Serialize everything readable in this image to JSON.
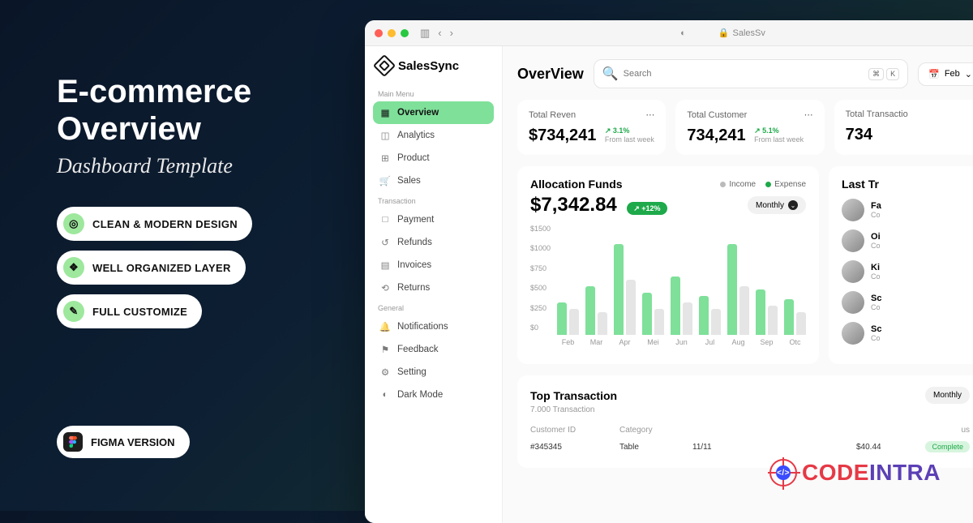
{
  "promo": {
    "title_l1": "E-commerce",
    "title_l2": "Overview",
    "subtitle": "Dashboard Template",
    "feat1": "CLEAN & MODERN DESIGN",
    "feat2": "WELL ORGANIZED LAYER",
    "feat3": "FULL CUSTOMIZE",
    "figma": "FIGMA VERSION"
  },
  "titlebar": {
    "url": "SalesSv"
  },
  "brand": "SalesSync",
  "nav": {
    "sec1": "Main Menu",
    "overview": "Overview",
    "analytics": "Analytics",
    "product": "Product",
    "sales": "Sales",
    "sec2": "Transaction",
    "payment": "Payment",
    "refunds": "Refunds",
    "invoices": "Invoices",
    "returns": "Returns",
    "sec3": "General",
    "notifications": "Notifications",
    "feedback": "Feedback",
    "setting": "Setting",
    "darkmode": "Dark Mode"
  },
  "header": {
    "title": "OverView",
    "search_placeholder": "Search",
    "kbd1": "⌘",
    "kbd2": "K",
    "month": "Feb"
  },
  "stats": {
    "s1_label": "Total Reven",
    "s1_val": "$734,241",
    "s1_pct": "↗ 3.1%",
    "s1_sub": "From last week",
    "s2_label": "Total Customer",
    "s2_val": "734,241",
    "s2_pct": "↗ 5.1%",
    "s2_sub": "From last week",
    "s3_label": "Total Transactio",
    "s3_val": "734"
  },
  "alloc": {
    "title": "Allocation Funds",
    "legend_income": "Income",
    "legend_expense": "Expense",
    "amount": "$7,342.84",
    "delta": "↗ +12%",
    "period": "Monthly"
  },
  "chart_data": {
    "type": "bar",
    "title": "Allocation Funds",
    "ylabel": "",
    "xlabel": "",
    "ylim": [
      0,
      1500
    ],
    "yticks": [
      "$1500",
      "$1000",
      "$750",
      "$500",
      "$250",
      "$0"
    ],
    "categories": [
      "Feb",
      "Mar",
      "Apr",
      "Mei",
      "Jun",
      "Jul",
      "Aug",
      "Sep",
      "Otc"
    ],
    "series": [
      {
        "name": "Income",
        "values": [
          500,
          750,
          1400,
          650,
          900,
          600,
          1400,
          700,
          550
        ]
      },
      {
        "name": "Expense",
        "values": [
          400,
          350,
          850,
          400,
          500,
          400,
          750,
          450,
          350
        ]
      }
    ]
  },
  "lasttr": {
    "title": "Last Tr",
    "items": [
      {
        "name": "Fa",
        "sub": "Co"
      },
      {
        "name": "Oi",
        "sub": "Co"
      },
      {
        "name": "Ki",
        "sub": "Co"
      },
      {
        "name": "Sc",
        "sub": "Co"
      },
      {
        "name": "Sc",
        "sub": "Co"
      }
    ]
  },
  "toptr": {
    "title": "Top Transaction",
    "sub": "7.000 Transaction",
    "period": "Monthly",
    "col1": "Customer ID",
    "col2": "Category",
    "col5": "us",
    "r1_id": "#345345",
    "r1_cat": "Table",
    "r1_date": "11/11",
    "r1_amt": "$40.44",
    "r1_status": "Complete"
  },
  "watermark": {
    "a": "CODE",
    "b": "INTRA"
  }
}
